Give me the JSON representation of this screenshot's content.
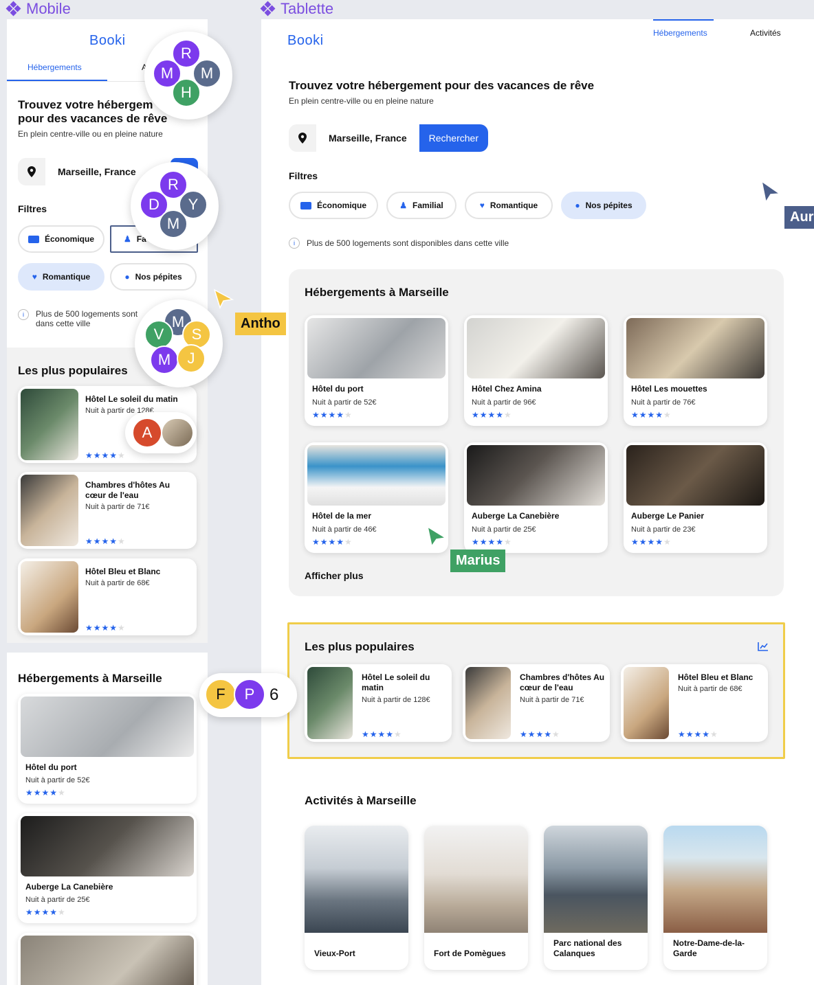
{
  "frames": {
    "mobile_label": "Mobile",
    "tablet_label": "Tablette"
  },
  "brand": {
    "logo": "Booki",
    "accent": "#2563eb"
  },
  "nav": {
    "tab_accommodations": "Hébergements",
    "tab_activities": "Activités",
    "tab_activities_cut": "A"
  },
  "hero": {
    "title": "Trouvez votre hébergement pour des vacances de rêve",
    "mobile_title_line1": "Trouvez votre hébergem",
    "mobile_title_line2": "pour des vacances de rêve",
    "subtitle": "En plein centre-ville ou en pleine nature"
  },
  "search": {
    "location": "Marseille, France",
    "button": "Rechercher"
  },
  "filters": {
    "title": "Filtres",
    "items": [
      "Économique",
      "Familial",
      "Romantique",
      "Nos pépites"
    ],
    "mobile_familial_cut": "Fa",
    "selected_tablet": "Nos pépites",
    "selected_mobile": "Romantique"
  },
  "info": {
    "text": "Plus de 500 logements sont disponibles dans cette ville",
    "mobile_line1": "Plus de 500 logements sont",
    "mobile_line2": "dans cette ville"
  },
  "hebergements": {
    "title": "Hébergements à Marseille",
    "more": "Afficher plus",
    "items": [
      {
        "name": "Hôtel du port",
        "price": "Nuit à partir de 52€",
        "rating": 4
      },
      {
        "name": "Hôtel Chez Amina",
        "price": "Nuit à partir de 96€",
        "rating": 4
      },
      {
        "name": "Hôtel Les mouettes",
        "price": "Nuit à partir de 76€",
        "rating": 4
      },
      {
        "name": "Hôtel de la mer",
        "price": "Nuit à partir de 46€",
        "rating": 4
      },
      {
        "name": "Auberge La Canebière",
        "price": "Nuit à partir de 25€",
        "rating": 4
      },
      {
        "name": "Auberge Le Panier",
        "price": "Nuit à partir de 23€",
        "rating": 4
      }
    ],
    "mobile_items": [
      {
        "name": "Hôtel du port",
        "price": "Nuit à partir de 52€"
      },
      {
        "name": "Auberge La Canebière",
        "price": "Nuit à partir de 25€"
      }
    ]
  },
  "populaires": {
    "title": "Les plus populaires",
    "items": [
      {
        "name": "Hôtel Le soleil du matin",
        "price": "Nuit à partir de 128€",
        "rating": 4
      },
      {
        "name": "Chambres d'hôtes Au cœur de l'eau",
        "price": "Nuit à partir de 71€",
        "rating": 4
      },
      {
        "name": "Hôtel Bleu et Blanc",
        "price": "Nuit à partir de 68€",
        "rating": 4
      }
    ],
    "tablet_name1_line1": "Hôtel Le soleil du",
    "tablet_name1_line2": "matin"
  },
  "activites": {
    "title": "Activités à Marseille",
    "items": [
      "Vieux-Port",
      "Fort de Pomègues",
      "Parc national des Calanques",
      "Notre-Dame-de-la-Garde"
    ]
  },
  "collaborators": {
    "cluster1": [
      "R",
      "M",
      "M",
      "H"
    ],
    "cluster2": [
      "R",
      "D",
      "Y",
      "M"
    ],
    "cluster3": [
      "M",
      "V",
      "S",
      "M",
      "J"
    ],
    "single": "A",
    "row": [
      "F",
      "P"
    ],
    "row_count": "6",
    "cursors": [
      "Antho",
      "Marius",
      "Aur"
    ]
  }
}
